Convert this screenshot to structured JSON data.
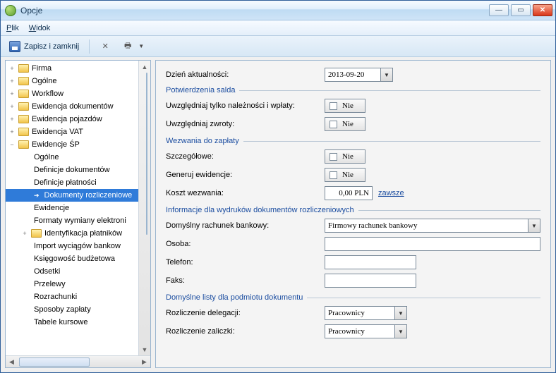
{
  "window": {
    "title": "Opcje"
  },
  "menubar": {
    "file_html": "<u>P</u>lik",
    "view_html": "<u>W</u>idok"
  },
  "toolbar": {
    "save_close": "Zapisz i zamknij"
  },
  "tree": {
    "firma": "Firma",
    "ogolne": "Ogólne",
    "workflow": "Workflow",
    "ewid_dok": "Ewidencja dokumentów",
    "ewid_poj": "Ewidencja pojazdów",
    "ewid_vat": "Ewidencja VAT",
    "ewid_sp": "Ewidencje ŚP",
    "sp_ogolne": "Ogólne",
    "sp_def_dok": "Definicje dokumentów",
    "sp_def_plat": "Definicje płatności",
    "sp_dok_rozl": "Dokumenty rozliczeniowe",
    "sp_ewidencje": "Ewidencje",
    "sp_formaty": "Formaty wymiany elektroni",
    "ident_plat": "Identyfikacja płatników",
    "import_wyc": "Import wyciągów bankow",
    "ksieg_budz": "Księgowość budżetowa",
    "odsetki": "Odsetki",
    "przelewy": "Przelewy",
    "rozrachunki": "Rozrachunki",
    "sposoby": "Sposoby zapłaty",
    "tabele": "Tabele kursowe"
  },
  "form": {
    "date_label": "Dzień aktualności:",
    "date_value": "2013-09-20",
    "fs_salda": "Potwierdzenia salda",
    "uwzgl_nalez": "Uwzględniaj tylko należności i wpłaty:",
    "uwzgl_zwroty": "Uwzględniaj zwroty:",
    "nie": "Nie",
    "fs_wezw": "Wezwania do zapłaty",
    "szczegolowe": "Szczegółowe:",
    "generuj_ewid": "Generuj ewidencje:",
    "koszt_wezw": "Koszt wezwania:",
    "koszt_value": "0,00 PLN",
    "zawsze": "zawsze",
    "fs_info": "Informacje dla wydruków dokumentów rozliczeniowych",
    "dom_rachunek": "Domyślny rachunek bankowy:",
    "dom_rachunek_val": "Firmowy rachunek bankowy",
    "osoba": "Osoba:",
    "telefon": "Telefon:",
    "faks": "Faks:",
    "fs_listy": "Domyślne listy dla podmiotu dokumentu",
    "rozl_deleg": "Rozliczenie delegacji:",
    "rozl_zal": "Rozliczenie zaliczki:",
    "pracownicy": "Pracownicy"
  }
}
